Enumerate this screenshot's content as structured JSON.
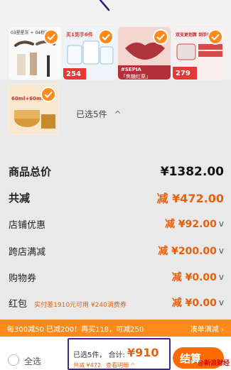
{
  "products": [
    {
      "caption_top": "03星星灰 + 04棕灰棕",
      "selected": true
    },
    {
      "caption_top": "买1到手6件",
      "price": "254",
      "selected": true
    },
    {
      "caption_top": "#SEPIA",
      "caption_bottom": "「焦糖红栗」",
      "selected": true
    },
    {
      "caption_top": "双支更划算 到手价",
      "price": "279",
      "selected": true
    },
    {
      "caption_top": "60ml+60ml",
      "selected": true
    }
  ],
  "selection": {
    "count_label": "已选5件",
    "chevron": "chevron-up-icon"
  },
  "totals": {
    "goods_total_label": "商品总价",
    "goods_total_value": "¥1382.00",
    "discount_label": "共减",
    "discount_value": "减 ¥472.00"
  },
  "breakdown": [
    {
      "label": "店铺优惠",
      "value": "减 ¥92.00"
    },
    {
      "label": "跨店满减",
      "value": "减 ¥200.00"
    },
    {
      "label": "购物券",
      "value": "减 ¥0.00"
    },
    {
      "label": "红包",
      "note": "实付差1910元可用 ¥240消费券",
      "value": "减 ¥0.00"
    }
  ],
  "promo_banner": {
    "text": "每300减50 已减200！再买118，可减250",
    "link": "凑单满减 ›"
  },
  "bottom_bar": {
    "select_all": "全选",
    "summary": "已选5件， 合计:",
    "total": "¥910",
    "saved": "共减 ¥472",
    "detail": "查看明细 ^",
    "checkout": "结算"
  },
  "watermark": "@新浪财经",
  "colors": {
    "accent": "#ff8a1a",
    "checkout": "#ff6a00",
    "discount": "#e8600c",
    "highlight_border": "#3a2a8a"
  }
}
